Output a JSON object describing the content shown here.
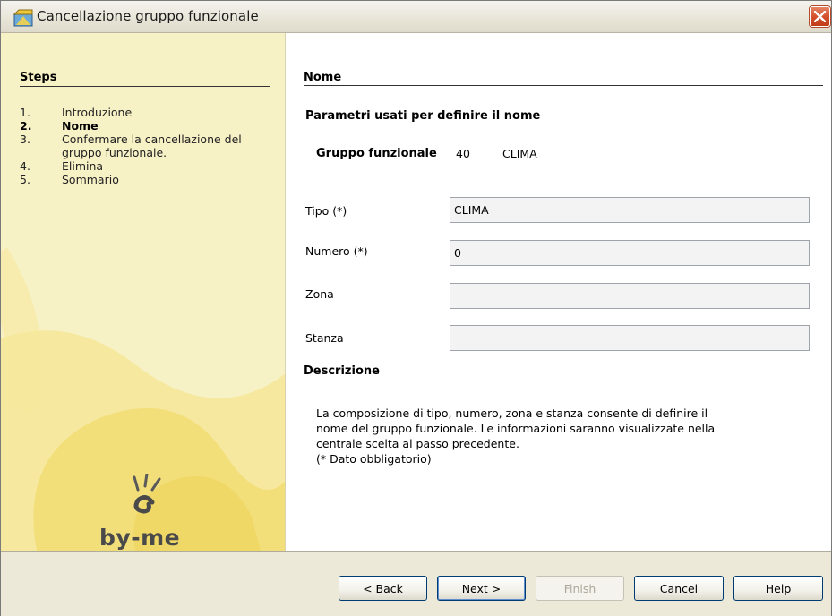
{
  "window": {
    "title": "Cancellazione gruppo funzionale"
  },
  "sidebar": {
    "heading": "Steps",
    "steps": [
      {
        "number": "1.",
        "label": "Introduzione",
        "active": false
      },
      {
        "number": "2.",
        "label": "Nome",
        "active": true
      },
      {
        "number": "3.",
        "label": "Confermare la cancellazione del gruppo funzionale.",
        "active": false
      },
      {
        "number": "4.",
        "label": "Elimina",
        "active": false
      },
      {
        "number": "5.",
        "label": "Sommario",
        "active": false
      }
    ],
    "logo_text": "by-me"
  },
  "main": {
    "heading": "Nome",
    "section_title": "Parametri usati per definire il nome",
    "group": {
      "label": "Gruppo funzionale",
      "number": "40",
      "name": "CLIMA"
    },
    "fields": [
      {
        "label": "Tipo (*)",
        "value": "CLIMA"
      },
      {
        "label": "Numero (*)",
        "value": "0"
      },
      {
        "label": "Zona",
        "value": ""
      },
      {
        "label": "Stanza",
        "value": ""
      }
    ],
    "description_title": "Descrizione",
    "description": "La composizione di tipo, numero, zona e stanza consente di definire il\nnome del gruppo funzionale. Le informazioni saranno visualizzate nella\ncentrale scelta al passo precedente.\n(* Dato obbligatorio)"
  },
  "buttons": {
    "back": "< Back",
    "next": "Next >",
    "finish": "Finish",
    "cancel": "Cancel",
    "help": "Help"
  },
  "colors": {
    "sidebar_bg": "#f7f1c6",
    "sidebar_swirl": "#f3e07a",
    "close_button": "#d4512d"
  }
}
